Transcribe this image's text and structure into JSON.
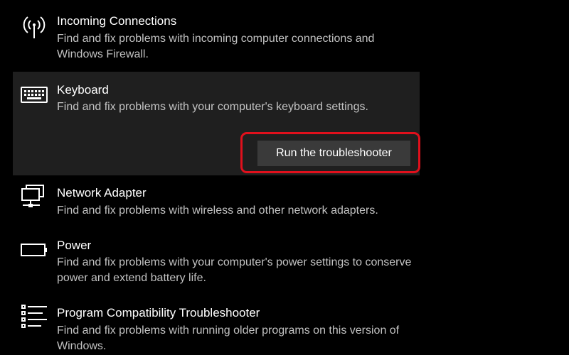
{
  "items": [
    {
      "title": "Incoming Connections",
      "description": "Find and fix problems with incoming computer connections and Windows Firewall.",
      "icon": "wireless-antenna-icon"
    },
    {
      "title": "Keyboard",
      "description": "Find and fix problems with your computer's keyboard settings.",
      "icon": "keyboard-icon",
      "expanded": true,
      "button_label": "Run the troubleshooter"
    },
    {
      "title": "Network Adapter",
      "description": "Find and fix problems with wireless and other network adapters.",
      "icon": "network-monitor-icon"
    },
    {
      "title": "Power",
      "description": "Find and fix problems with your computer's power settings to conserve power and extend battery life.",
      "icon": "battery-icon"
    },
    {
      "title": "Program Compatibility Troubleshooter",
      "description": "Find and fix problems with running older programs on this version of Windows.",
      "icon": "list-icon"
    }
  ],
  "colors": {
    "background": "#000000",
    "selected_item_background": "#1f1f1f",
    "button_background": "#3a3a3a",
    "highlight_border": "#e0101c",
    "description_text": "#c2c2c2"
  }
}
